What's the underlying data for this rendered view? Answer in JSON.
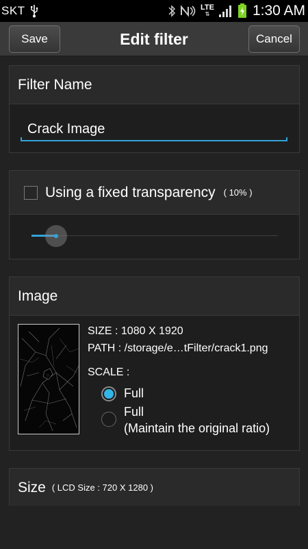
{
  "status_bar": {
    "carrier": "SKT",
    "network": "LTE",
    "battery_level": 0.85,
    "time": "1:30 AM"
  },
  "header": {
    "title": "Edit filter",
    "save_label": "Save",
    "cancel_label": "Cancel"
  },
  "filter_name": {
    "heading": "Filter Name",
    "value": "Crack Image"
  },
  "transparency": {
    "label": "Using a fixed transparency",
    "checked": false,
    "percent_label": "( 10% )",
    "value_fraction": 0.1
  },
  "image": {
    "heading": "Image",
    "size_text": "SIZE : 1080 X 1920",
    "path_text": "PATH : /storage/e…tFilter/crack1.png",
    "scale_label": "SCALE :",
    "options": [
      {
        "label": "Full",
        "selected": true
      },
      {
        "label": "Full\n(Maintain the original ratio)",
        "selected": false
      }
    ],
    "option_line1": "Full",
    "option2_line1": "Full",
    "option2_line2": "(Maintain the original ratio)"
  },
  "size": {
    "heading": "Size",
    "lcd_size_label": "( LCD Size : 720 X 1280 )"
  },
  "colors": {
    "accent": "#33b5e5",
    "background": "#222222",
    "header_bg": "#3a3a3a"
  }
}
